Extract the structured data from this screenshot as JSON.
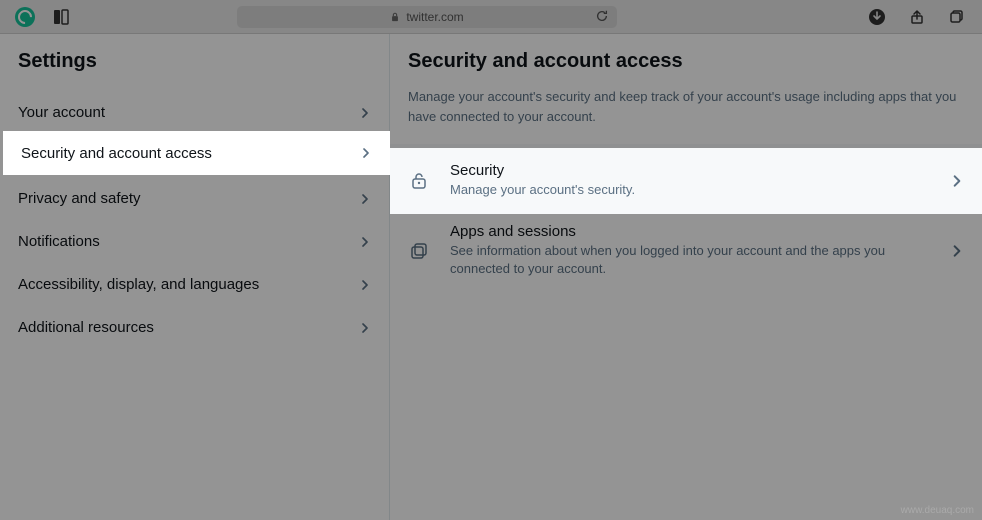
{
  "browser": {
    "url_host": "twitter.com"
  },
  "sidebar": {
    "title": "Settings",
    "items": [
      {
        "label": "Your account"
      },
      {
        "label": "Security and account access"
      },
      {
        "label": "Privacy and safety"
      },
      {
        "label": "Notifications"
      },
      {
        "label": "Accessibility, display, and languages"
      },
      {
        "label": "Additional resources"
      }
    ],
    "active_index": 1
  },
  "pane": {
    "title": "Security and account access",
    "description": "Manage your account's security and keep track of your account's usage including apps that you have connected to your account.",
    "options": [
      {
        "title": "Security",
        "subtitle": "Manage your account's security."
      },
      {
        "title": "Apps and sessions",
        "subtitle": "See information about when you logged into your account and the apps you connected to your account."
      }
    ],
    "active_option_index": 0
  },
  "watermark": "www.deuaq.com"
}
